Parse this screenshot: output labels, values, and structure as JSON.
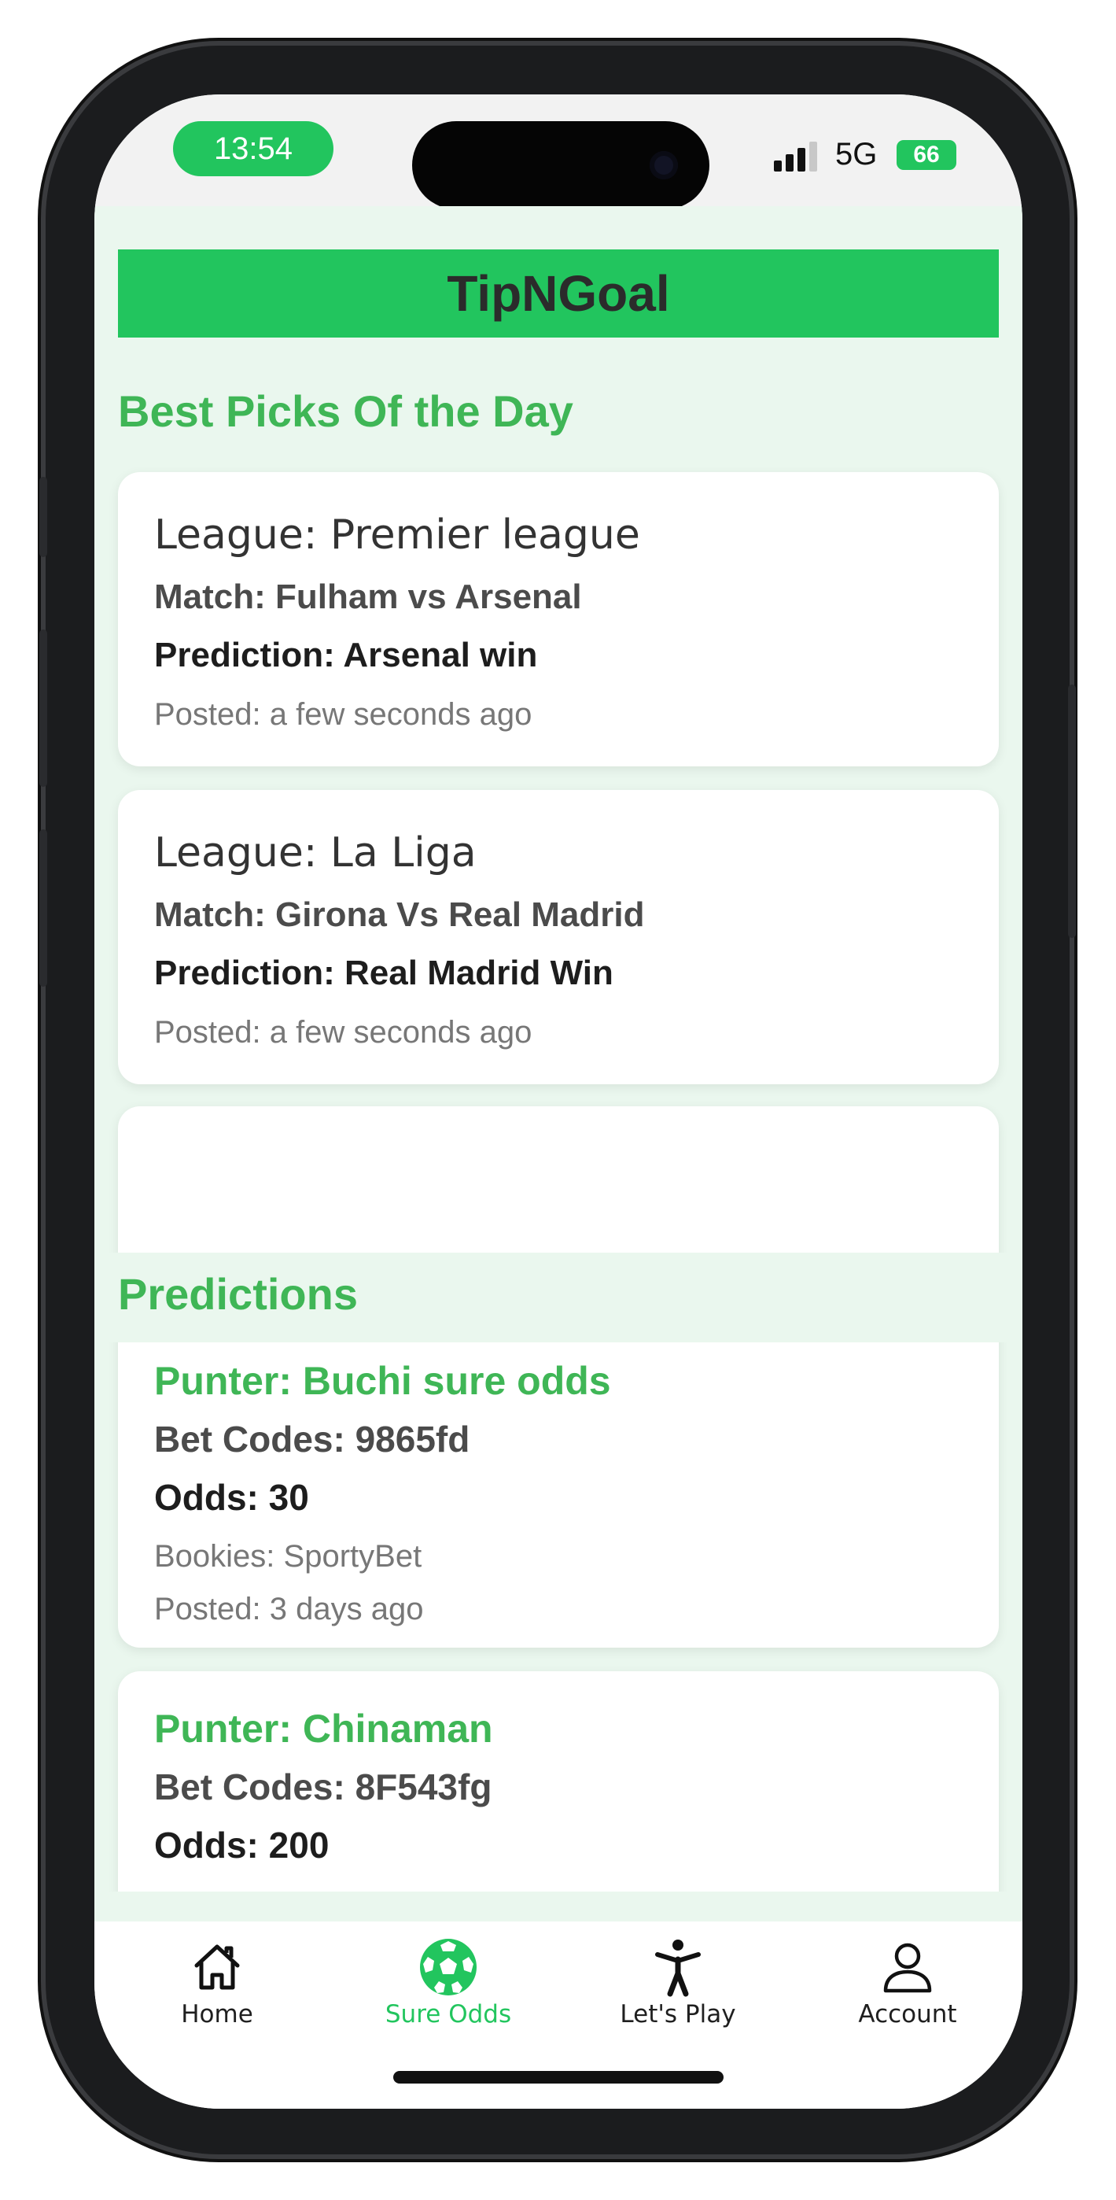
{
  "status_bar": {
    "time": "13:54",
    "network": "5G",
    "battery": "66"
  },
  "app": {
    "title": "TipNGoal"
  },
  "best_picks": {
    "title": "Best Picks Of the Day",
    "cards": [
      {
        "league": "League: Premier league",
        "match": "Match: Fulham vs  Arsenal",
        "prediction": "Prediction: Arsenal win",
        "posted": "Posted: a few seconds ago"
      },
      {
        "league": "League: La Liga",
        "match": "Match: Girona Vs Real Madrid",
        "prediction": "Prediction: Real Madrid Win",
        "posted": "Posted: a few seconds ago"
      }
    ]
  },
  "predictions": {
    "title": "Predictions",
    "cards": [
      {
        "punter": "Punter: Buchi sure odds",
        "bet_codes": "Bet Codes: 9865fd",
        "odds": "Odds: 30",
        "bookies": "Bookies: SportyBet",
        "posted": "Posted: 3 days ago"
      },
      {
        "punter": "Punter: Chinaman",
        "bet_codes": "Bet Codes: 8F543fg",
        "odds": "Odds: 200"
      }
    ]
  },
  "tab_bar": {
    "items": [
      {
        "label": "Home",
        "icon": "home-icon",
        "active": false
      },
      {
        "label": "Sure Odds",
        "icon": "soccer-ball-icon",
        "active": true
      },
      {
        "label": "Let's Play",
        "icon": "person-icon",
        "active": false
      },
      {
        "label": "Account",
        "icon": "account-icon",
        "active": false
      }
    ]
  },
  "colors": {
    "accent": "#22c55e",
    "section_title": "#3fb656",
    "background": "#eaf7ee"
  }
}
